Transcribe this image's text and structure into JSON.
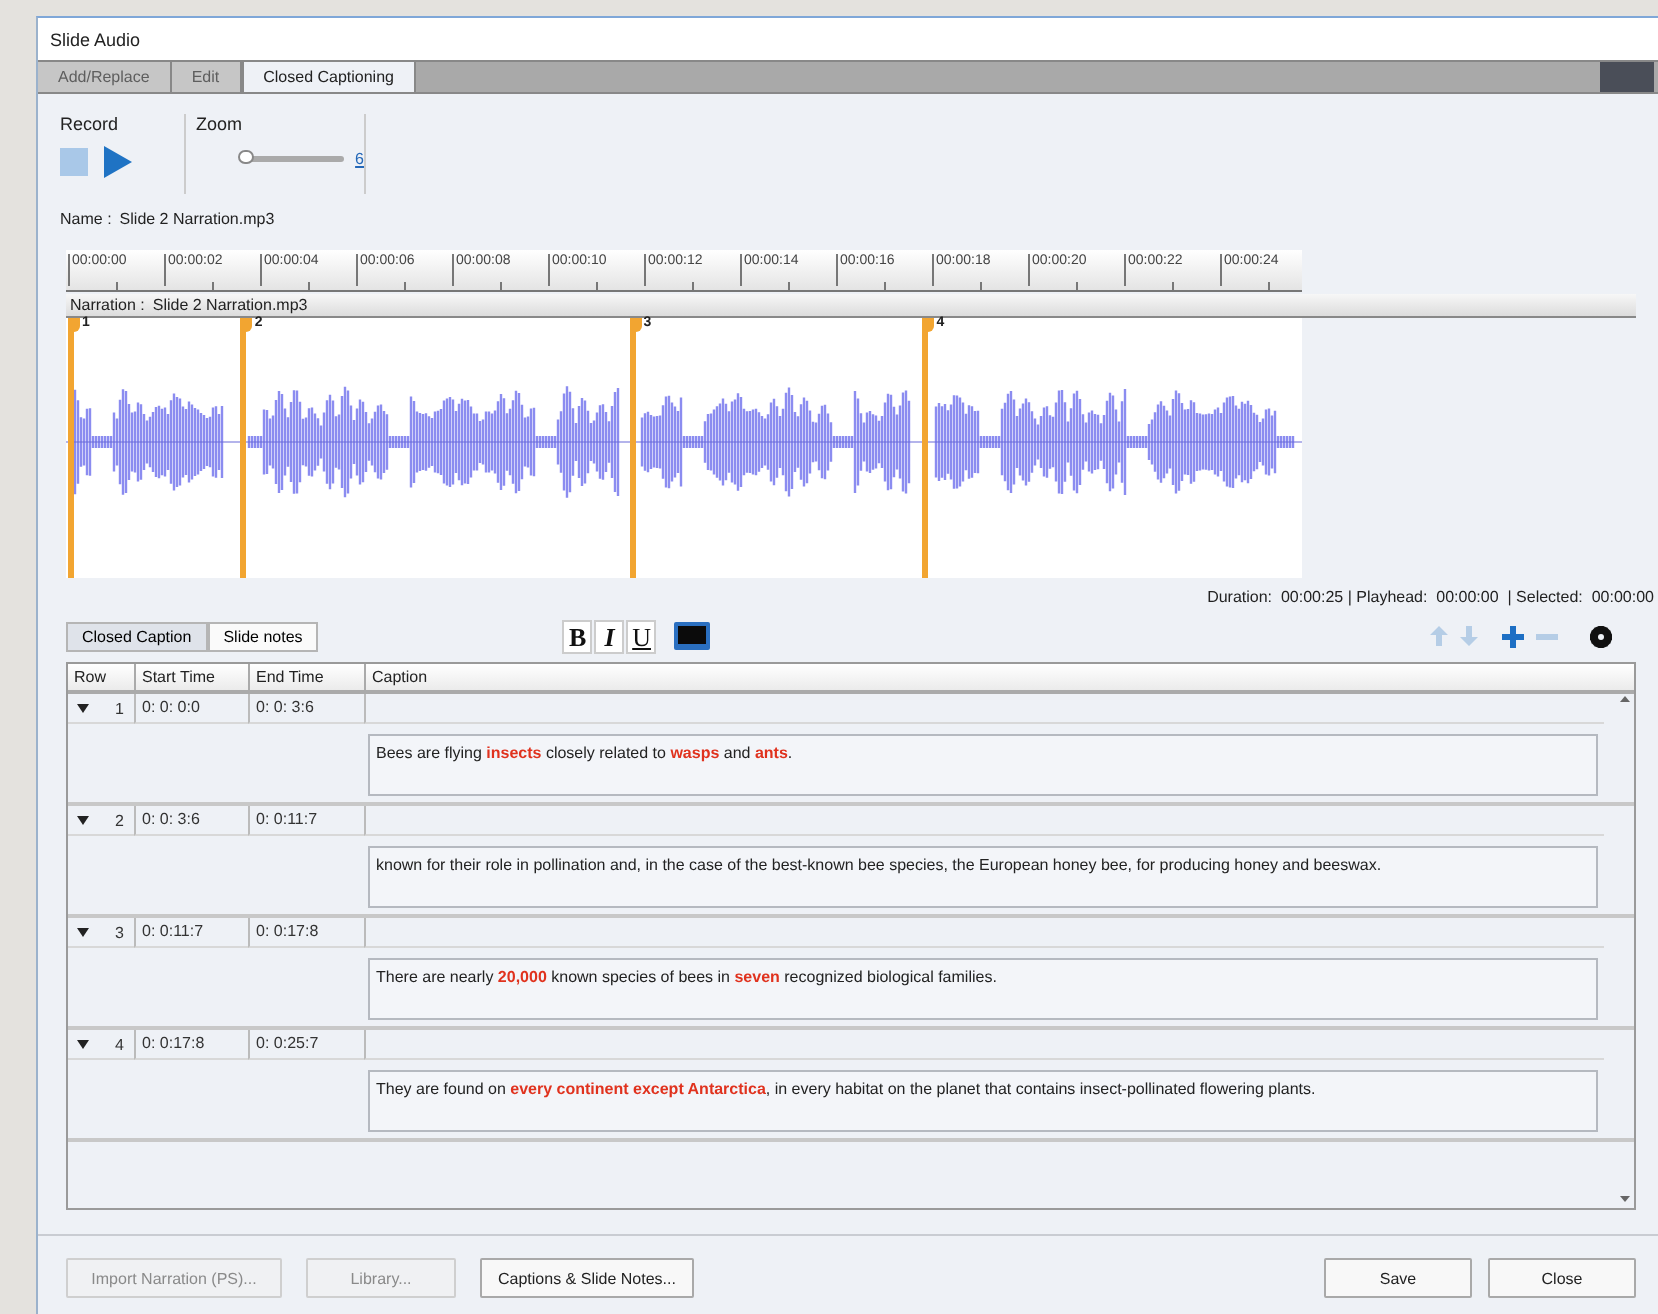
{
  "window": {
    "title": "Slide Audio"
  },
  "tabs": [
    {
      "label": "Add/Replace",
      "selected": false,
      "disabled": true
    },
    {
      "label": "Edit",
      "selected": false,
      "disabled": true
    },
    {
      "label": "Closed Captioning",
      "selected": true,
      "disabled": false
    }
  ],
  "record": {
    "label": "Record",
    "controls": [
      {
        "kind": "stop",
        "disabled": true
      },
      {
        "kind": "play",
        "disabled": false
      }
    ]
  },
  "zoom": {
    "label": "Zoom",
    "level": 0.05,
    "value": "6"
  },
  "name": {
    "label": "Name :",
    "value": "Slide 2 Narration.mp3"
  },
  "ruler": {
    "ticks": [
      "00:00:00",
      "00:00:02",
      "00:00:04",
      "00:00:06",
      "00:00:08",
      "00:00:10",
      "00:00:12",
      "00:00:14",
      "00:00:16",
      "00:00:18",
      "00:00:20",
      "00:00:22",
      "00:00:24"
    ]
  },
  "narration": {
    "label": "Narration :",
    "value": "Slide 2 Narration.mp3"
  },
  "markers": [
    {
      "label": "1"
    },
    {
      "label": "2"
    },
    {
      "label": "3"
    },
    {
      "label": "4"
    }
  ],
  "status": "Duration:  00:00:25 | Playhead:  00:00:00  | Selected:  00:00:00",
  "caption_tabs": [
    {
      "label": "Closed Caption",
      "selected": true
    },
    {
      "label": "Slide notes",
      "selected": false
    }
  ],
  "format_buttons": [
    {
      "kind": "bold",
      "label": "B"
    },
    {
      "kind": "italic",
      "label": "I"
    },
    {
      "kind": "underline",
      "label": "U"
    }
  ],
  "row_tools": [
    {
      "kind": "up",
      "disabled": true
    },
    {
      "kind": "down",
      "disabled": true
    },
    {
      "kind": "add",
      "disabled": false
    },
    {
      "kind": "remove",
      "disabled": true
    },
    {
      "kind": "settings",
      "disabled": false
    }
  ],
  "table": {
    "columns": [
      "Row",
      "Start Time",
      "End Time",
      "Caption"
    ],
    "rows": [
      {
        "row": "1",
        "start_time": "0: 0: 0:0",
        "end_time": "0: 0: 3:6",
        "expanded": true,
        "caption": "Bees are flying **insects** closely related to **wasps** and **ants**."
      },
      {
        "row": "2",
        "start_time": "0: 0: 3:6",
        "end_time": "0: 0:11:7",
        "expanded": true,
        "caption": "known for their role in pollination and, in the case of the best-known bee species, the European honey bee, for producing honey and beeswax."
      },
      {
        "row": "3",
        "start_time": "0: 0:11:7",
        "end_time": "0: 0:17:8",
        "expanded": true,
        "caption": "There are nearly **20,000** known species of bees in **seven** recognized biological families."
      },
      {
        "row": "4",
        "start_time": "0: 0:17:8",
        "end_time": "0: 0:25:7",
        "expanded": true,
        "caption": "They are found on **every continent except Antarctica**, in every habitat on the planet that contains insect-pollinated flowering plants."
      }
    ]
  },
  "buttons": [
    {
      "label": "Import Narration (PS)...",
      "disabled": true
    },
    {
      "label": "Library...",
      "disabled": true
    },
    {
      "label": "Captions & Slide Notes...",
      "disabled": false
    },
    {
      "label": "Save",
      "disabled": false
    },
    {
      "label": "Close",
      "disabled": false
    }
  ]
}
